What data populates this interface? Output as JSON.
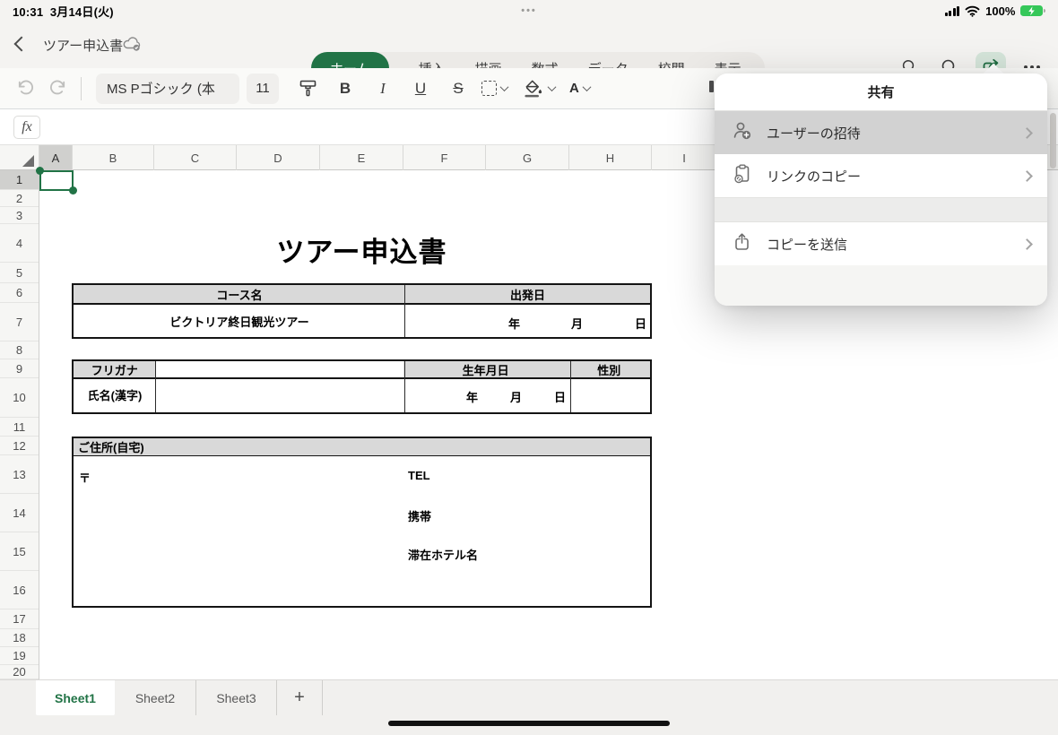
{
  "status_bar": {
    "time": "10:31",
    "date": "3月14日(火)",
    "battery_percent": "100%"
  },
  "title_bar": {
    "document_title": "ツアー申込書",
    "ribbon_tabs": [
      {
        "label": "ホーム",
        "active": true
      },
      {
        "label": "挿入",
        "active": false
      },
      {
        "label": "描画",
        "active": false
      },
      {
        "label": "数式",
        "active": false
      },
      {
        "label": "データ",
        "active": false
      },
      {
        "label": "校閲",
        "active": false
      },
      {
        "label": "表示",
        "active": false
      }
    ]
  },
  "format_toolbar": {
    "font_name": "MS Pゴシック (本",
    "font_size": "11",
    "bold_label": "B",
    "italic_label": "I",
    "underline_label": "U",
    "strikethrough_label": "S",
    "fontcolor_label": "A"
  },
  "formula_bar": {
    "fx_label": "fx",
    "value": ""
  },
  "grid": {
    "selected_cell": "A1",
    "columns": [
      "A",
      "B",
      "C",
      "D",
      "E",
      "F",
      "G",
      "H",
      "I"
    ],
    "rows": [
      "1",
      "2",
      "3",
      "4",
      "5",
      "6",
      "7",
      "8",
      "9",
      "10",
      "11",
      "12",
      "13",
      "14",
      "15",
      "16",
      "17",
      "18",
      "19",
      "20"
    ]
  },
  "worksheet": {
    "form_title": "ツアー申込書",
    "course_table": {
      "course_header": "コース名",
      "departure_header": "出発日",
      "course_name": "ビクトリア終日観光ツアー",
      "year_label": "年",
      "month_label": "月",
      "day_label": "日"
    },
    "person_table": {
      "furigana_label": "フリガナ",
      "birthdate_header": "生年月日",
      "gender_header": "性別",
      "name_label": "氏名(漢字)",
      "year_label": "年",
      "month_label": "月",
      "day_label": "日"
    },
    "address_table": {
      "header": "ご住所(自宅)",
      "postal_mark": "〒",
      "tel_label": "TEL",
      "mobile_label": "携帯",
      "hotel_label": "滞在ホテル名"
    }
  },
  "share_popover": {
    "title": "共有",
    "invite_item": "ユーザーの招待",
    "copy_link_item": "リンクのコピー",
    "send_copy_item": "コピーを送信"
  },
  "sheet_tab_bar": {
    "tabs": [
      {
        "label": "Sheet1",
        "active": true
      },
      {
        "label": "Sheet2",
        "active": false
      },
      {
        "label": "Sheet3",
        "active": false
      }
    ],
    "add_sheet_label": "+"
  },
  "colors": {
    "excel_green": "#217346",
    "share_button_bg": "#d5e5da",
    "table_header_fill": "#d9d9d9",
    "selected_item_bg": "#d2d2d2",
    "battery_green": "#35c759"
  }
}
